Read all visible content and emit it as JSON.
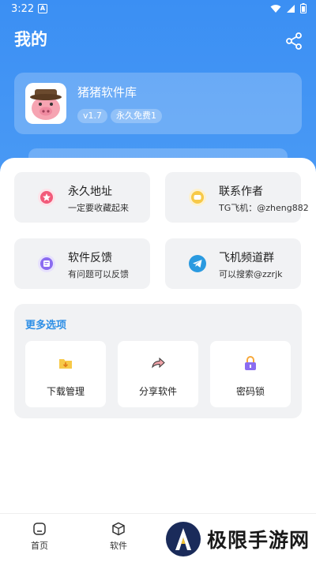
{
  "status_bar": {
    "time": "3:22"
  },
  "header": {
    "title": "我的"
  },
  "app_card": {
    "name": "猪猪软件库",
    "version": "v1.7",
    "tag": "永久免费1"
  },
  "tiles": [
    {
      "title": "永久地址",
      "subtitle": "一定要收藏起来",
      "color": "#f25a7a"
    },
    {
      "title": "联系作者",
      "subtitle": "TG飞机：@zheng882",
      "color": "#f7c948"
    },
    {
      "title": "软件反馈",
      "subtitle": "有问题可以反馈",
      "color": "#8b6cf0"
    },
    {
      "title": "飞机频道群",
      "subtitle": "可以搜索@zzrjk",
      "color": "#2a9ae0"
    }
  ],
  "more": {
    "title": "更多选项",
    "options": [
      {
        "label": "下载管理"
      },
      {
        "label": "分享软件"
      },
      {
        "label": "密码锁"
      }
    ]
  },
  "nav": {
    "home": "首页",
    "software": "软件"
  },
  "watermark": {
    "text": "极限手游网"
  },
  "colors": {
    "accent": "#3b8ff3",
    "section_title": "#2e8fe6"
  }
}
